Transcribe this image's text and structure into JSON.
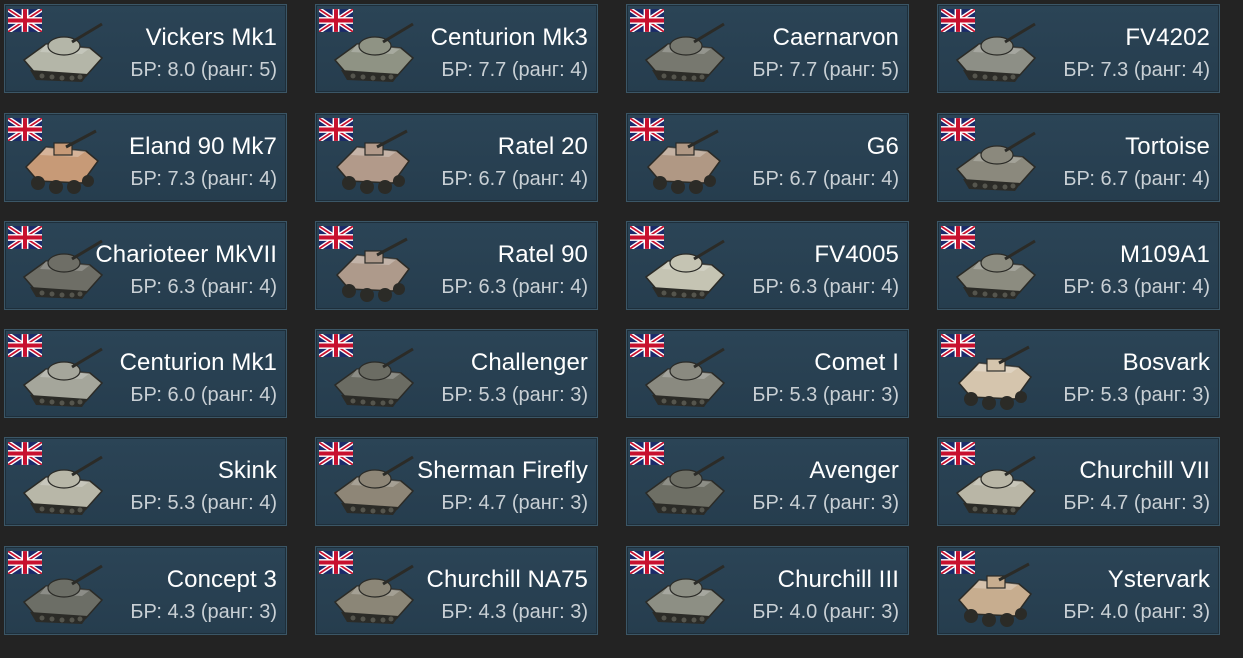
{
  "cards": [
    {
      "name": "Vickers Mk1",
      "br": "БР: 8.0 (ранг: 5)",
      "flag_icon": "uk-flag-icon",
      "tank_tone": "#b4b6a8",
      "tank_type": "tank"
    },
    {
      "name": "Centurion Mk3",
      "br": "БР: 7.7 (ранг: 4)",
      "flag_icon": "uk-flag-icon",
      "tank_tone": "#8f9384",
      "tank_type": "tank"
    },
    {
      "name": "Caernarvon",
      "br": "БР: 7.7 (ранг: 5)",
      "flag_icon": "uk-flag-icon",
      "tank_tone": "#77786f",
      "tank_type": "tank"
    },
    {
      "name": "FV4202",
      "br": "БР: 7.3 (ранг: 4)",
      "flag_icon": "uk-flag-icon",
      "tank_tone": "#8d8f86",
      "tank_type": "tank"
    },
    {
      "name": "Eland 90 Mk7",
      "br": "БР: 7.3 (ранг: 4)",
      "flag_icon": "uk-flag-icon",
      "tank_tone": "#c79a77",
      "tank_type": "wheeled"
    },
    {
      "name": "Ratel 20",
      "br": "БР: 6.7 (ранг: 4)",
      "flag_icon": "uk-flag-icon",
      "tank_tone": "#b29a8a",
      "tank_type": "wheeled"
    },
    {
      "name": "G6",
      "br": "БР: 6.7 (ранг: 4)",
      "flag_icon": "uk-flag-icon",
      "tank_tone": "#b09884",
      "tank_type": "wheeled"
    },
    {
      "name": "Tortoise",
      "br": "БР: 6.7 (ранг: 4)",
      "flag_icon": "uk-flag-icon",
      "tank_tone": "#8b897d",
      "tank_type": "tank"
    },
    {
      "name": "Charioteer MkVII",
      "br": "БР: 6.3 (ранг: 4)",
      "flag_icon": "uk-flag-icon",
      "tank_tone": "#6e6e66",
      "tank_type": "tank"
    },
    {
      "name": "Ratel 90",
      "br": "БР: 6.3 (ранг: 4)",
      "flag_icon": "uk-flag-icon",
      "tank_tone": "#ae9a8b",
      "tank_type": "wheeled"
    },
    {
      "name": "FV4005",
      "br": "БР: 6.3 (ранг: 4)",
      "flag_icon": "uk-flag-icon",
      "tank_tone": "#c5c4b3",
      "tank_type": "tank"
    },
    {
      "name": "M109A1",
      "br": "БР: 6.3 (ранг: 4)",
      "flag_icon": "uk-flag-icon",
      "tank_tone": "#8c8c80",
      "tank_type": "tank"
    },
    {
      "name": "Centurion Mk1",
      "br": "БР: 6.0 (ранг: 4)",
      "flag_icon": "uk-flag-icon",
      "tank_tone": "#a5a69b",
      "tank_type": "tank"
    },
    {
      "name": "Challenger",
      "br": "БР: 5.3 (ранг: 3)",
      "flag_icon": "uk-flag-icon",
      "tank_tone": "#6b6c63",
      "tank_type": "tank"
    },
    {
      "name": "Comet I",
      "br": "БР: 5.3 (ранг: 3)",
      "flag_icon": "uk-flag-icon",
      "tank_tone": "#8a8a80",
      "tank_type": "tank"
    },
    {
      "name": "Bosvark",
      "br": "БР: 5.3 (ранг: 3)",
      "flag_icon": "uk-flag-icon",
      "tank_tone": "#d5c5ad",
      "tank_type": "wheeled"
    },
    {
      "name": "Skink",
      "br": "БР: 5.3 (ранг: 4)",
      "flag_icon": "uk-flag-icon",
      "tank_tone": "#b8b7a8",
      "tank_type": "tank"
    },
    {
      "name": "Sherman Firefly",
      "br": "БР: 4.7 (ранг: 3)",
      "flag_icon": "uk-flag-icon",
      "tank_tone": "#8e8677",
      "tank_type": "tank"
    },
    {
      "name": "Avenger",
      "br": "БР: 4.7 (ранг: 3)",
      "flag_icon": "uk-flag-icon",
      "tank_tone": "#6e6f65",
      "tank_type": "tank"
    },
    {
      "name": "Churchill VII",
      "br": "БР: 4.7 (ранг: 3)",
      "flag_icon": "uk-flag-icon",
      "tank_tone": "#b9b6a6",
      "tank_type": "tank"
    },
    {
      "name": "Concept 3",
      "br": "БР: 4.3 (ранг: 3)",
      "flag_icon": "uk-flag-icon",
      "tank_tone": "#6c6e66",
      "tank_type": "tank"
    },
    {
      "name": "Churchill NA75",
      "br": "БР: 4.3 (ранг: 3)",
      "flag_icon": "uk-flag-icon",
      "tank_tone": "#8b8677",
      "tank_type": "tank"
    },
    {
      "name": "Churchill III",
      "br": "БР: 4.0 (ранг: 3)",
      "flag_icon": "uk-flag-icon",
      "tank_tone": "#8d8f84",
      "tank_type": "tank"
    },
    {
      "name": "Ystervark",
      "br": "БР: 4.0 (ранг: 3)",
      "flag_icon": "uk-flag-icon",
      "tank_tone": "#c7ad8f",
      "tank_type": "wheeled"
    }
  ],
  "colors": {
    "background": "#232323",
    "card_bg": "#2b4456",
    "card_border": "#3b5666",
    "name_text": "#ffffff",
    "br_text": "#c9d0d5"
  }
}
